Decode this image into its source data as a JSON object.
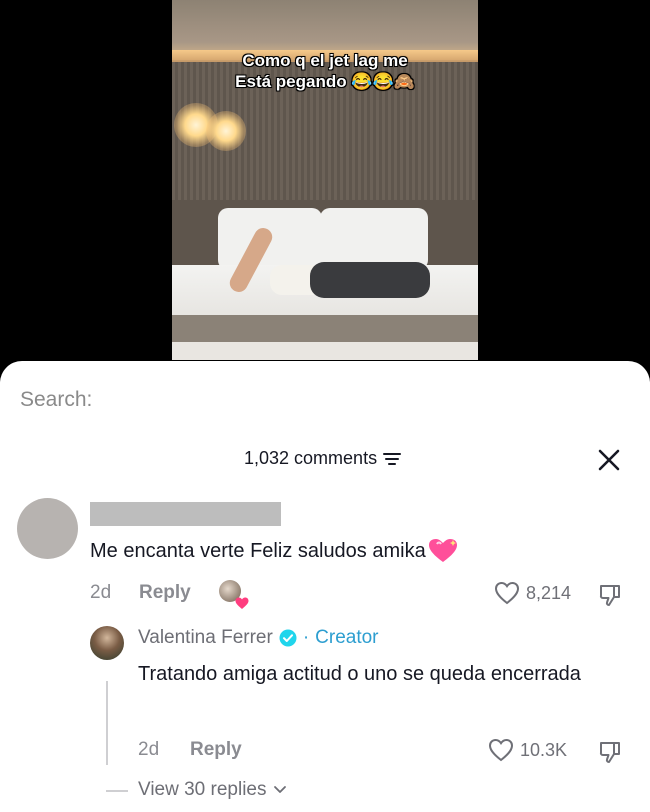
{
  "video": {
    "caption_line1": "Como q el jet lag me",
    "caption_line2": "Está pegando 😂😂🙈"
  },
  "search": {
    "label": "Search:"
  },
  "comments_header": {
    "count_text": "1,032 comments",
    "filter_icon": "filter-icon",
    "close_icon": "close-icon"
  },
  "comment": {
    "text": "Me encanta verte Feliz saludos amika",
    "emoji": "sparkling-heart",
    "age": "2d",
    "reply_label": "Reply",
    "likes": "8,214"
  },
  "reply": {
    "author": "Valentina Ferrer",
    "badge": "verified",
    "separator": "·",
    "role": "Creator",
    "text": "Tratando amiga actitud o uno se queda encerrada",
    "age": "2d",
    "reply_label": "Reply",
    "likes": "10.3K"
  },
  "view_replies": {
    "label": "View 30 replies"
  },
  "colors": {
    "accent": "#2d9ed0",
    "text": "#161823",
    "muted": "#8a8b91",
    "heart_pink": "#ff3d7f"
  }
}
